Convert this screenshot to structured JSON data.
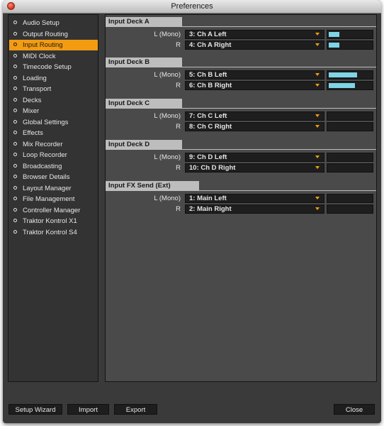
{
  "window": {
    "title": "Preferences"
  },
  "sidebar": {
    "items": [
      {
        "label": "Audio Setup",
        "active": false
      },
      {
        "label": "Output Routing",
        "active": false
      },
      {
        "label": "Input Routing",
        "active": true
      },
      {
        "label": "MIDI Clock",
        "active": false
      },
      {
        "label": "Timecode Setup",
        "active": false
      },
      {
        "label": "Loading",
        "active": false
      },
      {
        "label": "Transport",
        "active": false
      },
      {
        "label": "Decks",
        "active": false
      },
      {
        "label": "Mixer",
        "active": false
      },
      {
        "label": "Global Settings",
        "active": false
      },
      {
        "label": "Effects",
        "active": false
      },
      {
        "label": "Mix Recorder",
        "active": false
      },
      {
        "label": "Loop Recorder",
        "active": false
      },
      {
        "label": "Broadcasting",
        "active": false
      },
      {
        "label": "Browser Details",
        "active": false
      },
      {
        "label": "Layout Manager",
        "active": false
      },
      {
        "label": "File Management",
        "active": false
      },
      {
        "label": "Controller Manager",
        "active": false
      },
      {
        "label": "Traktor Kontrol X1",
        "active": false
      },
      {
        "label": "Traktor Kontrol S4",
        "active": false
      }
    ]
  },
  "sections": [
    {
      "title": "Input Deck A",
      "rows": [
        {
          "label": "L (Mono)",
          "value": "3: Ch A Left",
          "level": 0.24
        },
        {
          "label": "R",
          "value": "4: Ch A Right",
          "level": 0.24
        }
      ]
    },
    {
      "title": "Input Deck B",
      "rows": [
        {
          "label": "L (Mono)",
          "value": "5: Ch B Left",
          "level": 0.65
        },
        {
          "label": "R",
          "value": "6: Ch B Right",
          "level": 0.6
        }
      ]
    },
    {
      "title": "Input Deck C",
      "rows": [
        {
          "label": "L (Mono)",
          "value": "7: Ch C Left",
          "level": 0
        },
        {
          "label": "R",
          "value": "8: Ch C Right",
          "level": 0
        }
      ]
    },
    {
      "title": "Input Deck D",
      "rows": [
        {
          "label": "L (Mono)",
          "value": "9: Ch D Left",
          "level": 0
        },
        {
          "label": "R",
          "value": "10: Ch D Right",
          "level": 0
        }
      ]
    },
    {
      "title": "Input FX Send (Ext)",
      "rows": [
        {
          "label": "L (Mono)",
          "value": "1: Main Left",
          "level": 0
        },
        {
          "label": "R",
          "value": "2: Main Right",
          "level": 0
        }
      ]
    }
  ],
  "footer": {
    "setup_wizard": "Setup Wizard",
    "import": "Import",
    "export": "Export",
    "close": "Close"
  },
  "colors": {
    "accent": "#f39c12",
    "meter": "#7fd4e6",
    "panel_bg": "#4a4a4a",
    "window_bg": "#3a3a3a"
  }
}
